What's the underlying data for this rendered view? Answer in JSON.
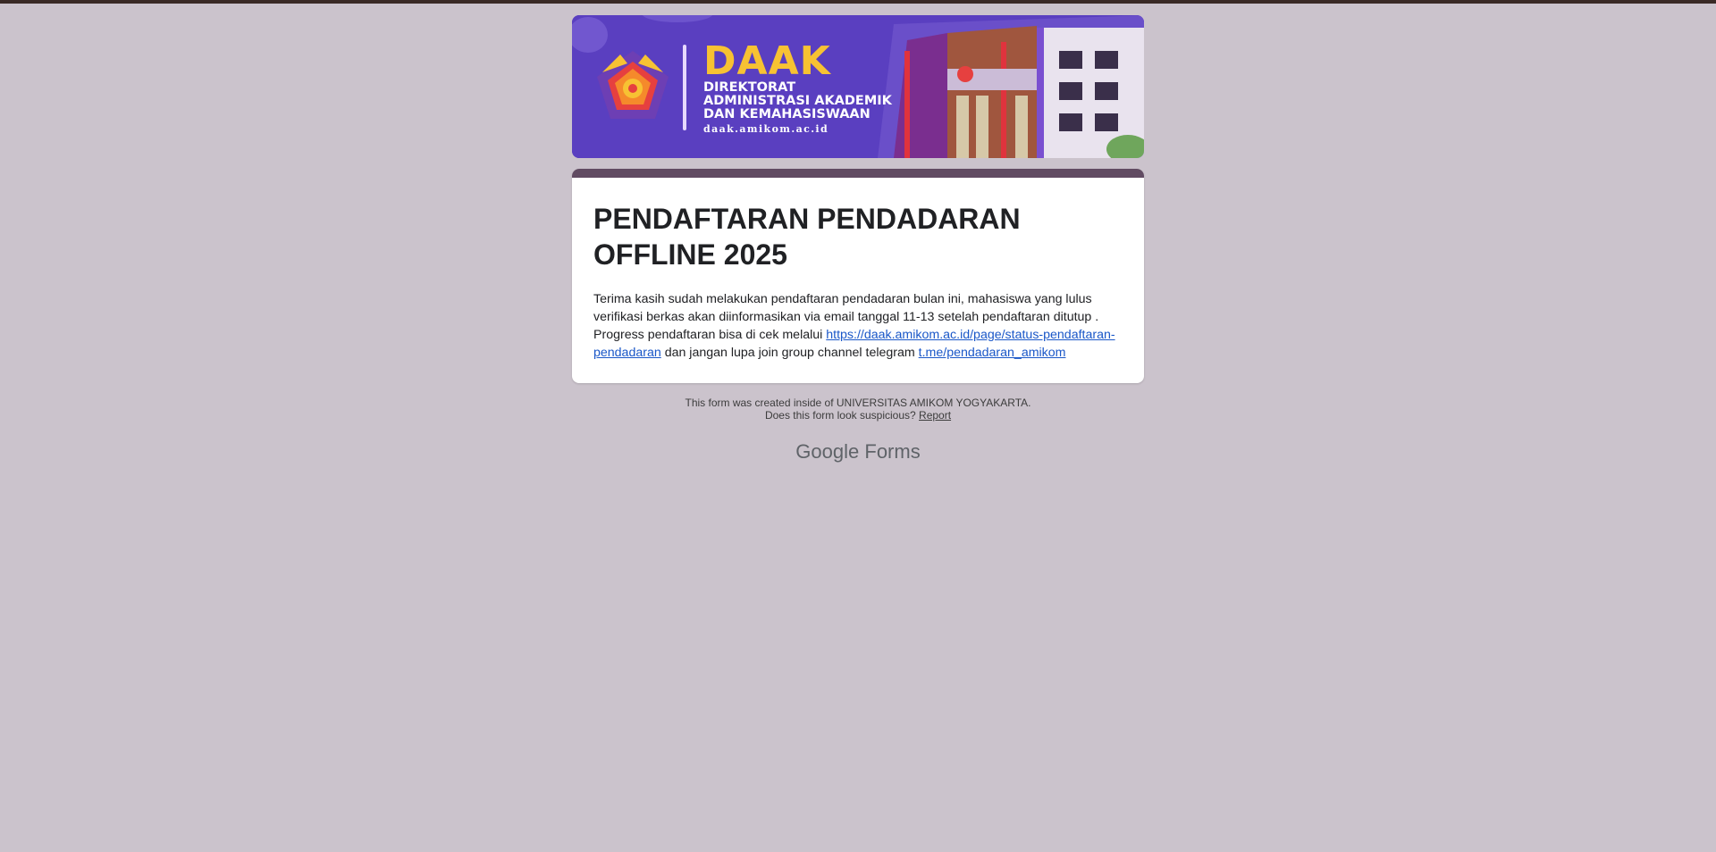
{
  "banner": {
    "title": "DAAK",
    "subtitle": "Direktorat Administrasi Akademik dan Kemahasiswaan",
    "url": "daak.amikom.ac.id",
    "colors": {
      "background": "#5a3fc0",
      "accent": "#f7c233"
    }
  },
  "form": {
    "title": "PENDAFTARAN PENDADARAN OFFLINE 2025",
    "description_part1": "Terima kasih sudah melakukan pendaftaran pendadaran bulan ini, mahasiswa yang lulus verifikasi berkas akan diinformasikan via email tanggal 11-13 setelah pendaftaran ditutup . Progress pendaftaran bisa di cek melalui ",
    "link1_text": "https://daak.amikom.ac.id/page/status-pendaftaran-pendadaran",
    "description_part2": " dan jangan lupa join group channel telegram ",
    "link2_text": "t.me/pendadaran_amikom"
  },
  "footer": {
    "created_text": "This form was created inside of UNIVERSITAS AMIKOM YOGYAKARTA.",
    "suspicious_text": "Does this form look suspicious?",
    "report_label": "Report",
    "brand_google": "Google",
    "brand_forms": "Forms"
  },
  "colors": {
    "page_background": "#cbc3cc",
    "card_accent_bar": "#614b62",
    "link": "#1a57c8"
  }
}
